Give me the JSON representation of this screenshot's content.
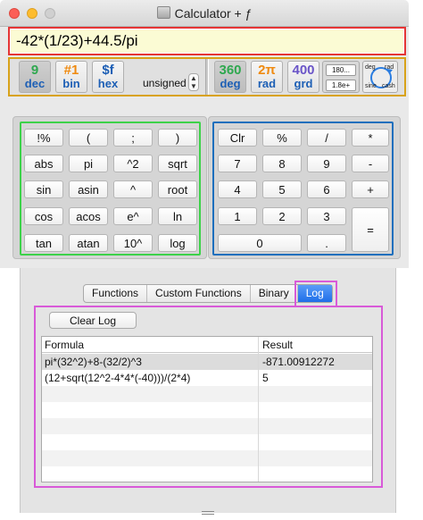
{
  "window": {
    "title": "Calculator + ƒ"
  },
  "expression": {
    "value": "-42*(1/23)+44.5/pi"
  },
  "modes": {
    "dec": {
      "top": "9",
      "bottom": "dec"
    },
    "bin": {
      "top": "#1",
      "bottom": "bin"
    },
    "hex": {
      "top": "$f",
      "bottom": "hex"
    },
    "signedness": "unsigned",
    "deg": {
      "top": "360",
      "bottom": "deg"
    },
    "rad": {
      "top": "2π",
      "bottom": "rad"
    },
    "grd": {
      "top": "400",
      "bottom": "grd"
    },
    "precision_top": "180...",
    "precision_bottom": "1.8e+",
    "gauge_labels": [
      "deg",
      "rad",
      "sine",
      "cash"
    ]
  },
  "function_keys": [
    [
      "!%",
      "(",
      ";",
      ")"
    ],
    [
      "abs",
      "pi",
      "^2",
      "sqrt"
    ],
    [
      "sin",
      "asin",
      "^",
      "root"
    ],
    [
      "cos",
      "acos",
      "e^",
      "ln"
    ],
    [
      "tan",
      "atan",
      "10^",
      "log"
    ]
  ],
  "number_keys": {
    "row1": [
      "Clr",
      "%",
      "/",
      "*"
    ],
    "row2": [
      "7",
      "8",
      "9",
      "-"
    ],
    "row3": [
      "4",
      "5",
      "6",
      "+"
    ],
    "row4": [
      "1",
      "2",
      "3"
    ],
    "zero": "0",
    "dot": ".",
    "equals": "="
  },
  "tabs": [
    "Functions",
    "Custom Functions",
    "Binary",
    "Log"
  ],
  "selected_tab": "Log",
  "log": {
    "clear_label": "Clear Log",
    "columns": [
      "Formula",
      "Result"
    ],
    "rows": [
      {
        "formula": "pi*(32^2)+8-(32/2)^3",
        "result": "-871.00912272"
      },
      {
        "formula": "(12+sqrt(12^2-4*4*(-40)))/(2*4)",
        "result": "5"
      }
    ]
  },
  "colors": {
    "expression_highlight": "#e53535",
    "mode_highlight": "#d8a21a",
    "function_pad_highlight": "#3dd24a",
    "number_pad_highlight": "#1d6fbd",
    "log_highlight": "#d85ad8",
    "expression_bg": "#fbfbd4"
  }
}
